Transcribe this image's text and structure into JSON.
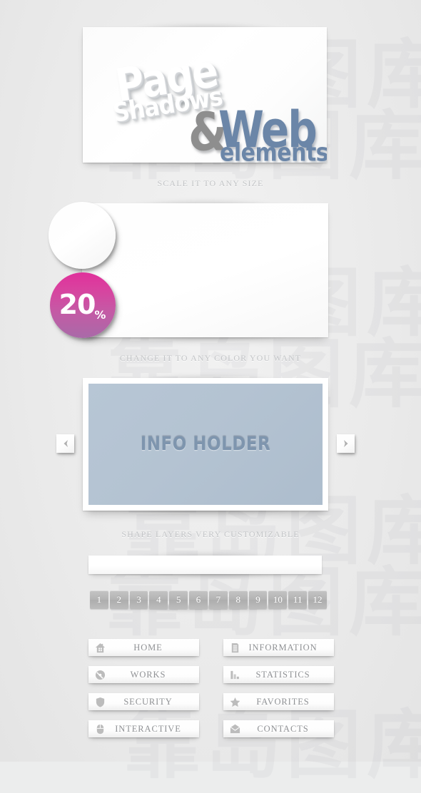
{
  "theme": {
    "background": "#ebecec",
    "caption_color": "#c3c5c7",
    "accent_blue": "#6b86a8",
    "info_panel_bg": "#b4c3d2",
    "pink_top": "#e0309b",
    "pink_bottom": "#a96aa8",
    "page_button_bg": "#b4b4b4"
  },
  "watermark": {
    "text": "靠岛图库"
  },
  "hero": {
    "line1": "Page",
    "line2": "Shadows",
    "amp": "&",
    "line3": "Web",
    "line4": "elements"
  },
  "captions": {
    "one": "SCALE IT TO ANY SIZE",
    "two": "CHANGE IT TO ANY COLOR YOU WANT",
    "three": "SHAPE LAYERS VERY CUSTOMIZABLE"
  },
  "badge": {
    "value": "20",
    "unit": "%"
  },
  "info_holder": {
    "label": "INFO HOLDER",
    "prev_icon": "chevron-left-icon",
    "next_icon": "chevron-right-icon"
  },
  "pagination": {
    "pages": [
      "1",
      "2",
      "3",
      "4",
      "5",
      "6",
      "7",
      "8",
      "9",
      "10",
      "11",
      "12"
    ]
  },
  "menu": {
    "items": [
      {
        "label": "HOME",
        "icon": "house-icon"
      },
      {
        "label": "INFORMATION",
        "icon": "document-icon"
      },
      {
        "label": "WORKS",
        "icon": "disc-icon"
      },
      {
        "label": "STATISTICS",
        "icon": "bar-chart-icon"
      },
      {
        "label": "SECURITY",
        "icon": "shield-icon"
      },
      {
        "label": "FAVORITES",
        "icon": "star-icon"
      },
      {
        "label": "INTERACTIVE",
        "icon": "mouse-icon"
      },
      {
        "label": "CONTACTS",
        "icon": "envelope-icon"
      }
    ]
  }
}
